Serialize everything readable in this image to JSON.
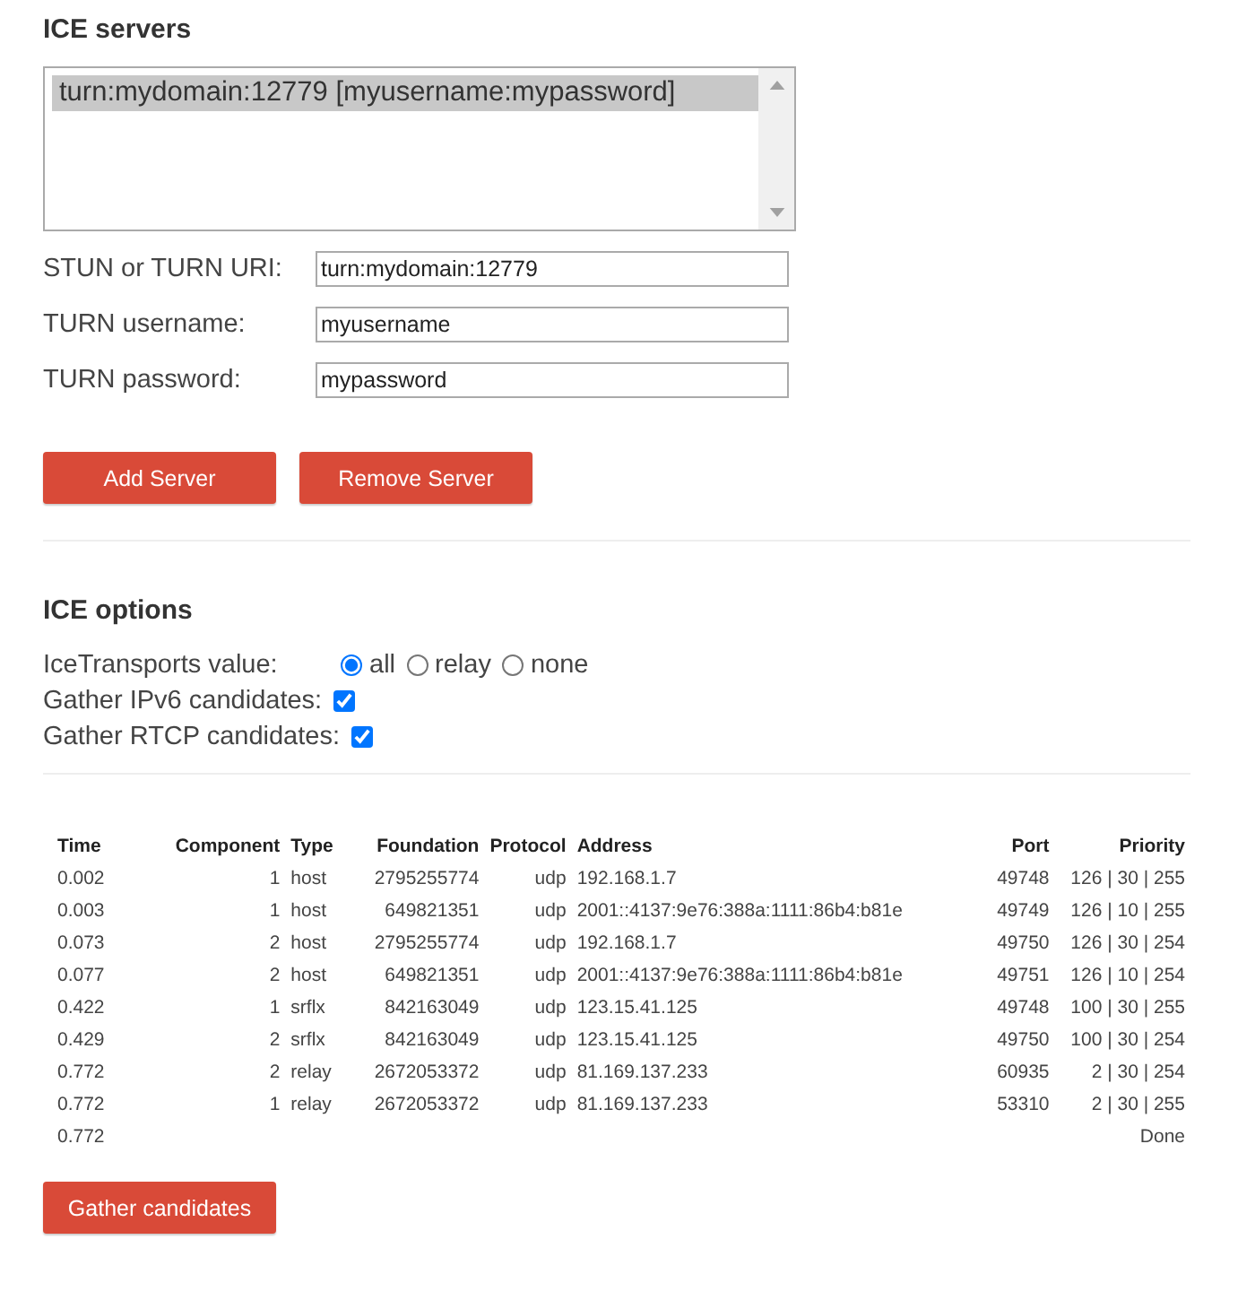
{
  "ice_servers": {
    "title": "ICE servers",
    "server_list": [
      {
        "label": "turn:mydomain:12779 [myusername:mypassword]",
        "selected": true
      }
    ],
    "fields": [
      {
        "label": "STUN or TURN URI:",
        "value": "turn:mydomain:12779"
      },
      {
        "label": "TURN username:",
        "value": "myusername"
      },
      {
        "label": "TURN password:",
        "value": "mypassword"
      }
    ],
    "buttons": [
      "Add Server",
      "Remove Server"
    ]
  },
  "ice_options": {
    "title": "ICE options",
    "transports": {
      "label": "IceTransports value:",
      "options": [
        {
          "label": "all",
          "selected": true
        },
        {
          "label": "relay",
          "selected": false
        },
        {
          "label": "none",
          "selected": false
        }
      ]
    },
    "checkboxes": [
      {
        "label": "Gather IPv6 candidates:",
        "checked": true
      },
      {
        "label": "Gather RTCP candidates:",
        "checked": true
      }
    ]
  },
  "candidates": {
    "columns": [
      "Time",
      "Component",
      "Type",
      "Foundation",
      "Protocol",
      "Address",
      "Port",
      "Priority"
    ],
    "rows": [
      [
        "0.002",
        "1",
        "host",
        "2795255774",
        "udp",
        "192.168.1.7",
        "49748",
        "126 | 30 | 255"
      ],
      [
        "0.003",
        "1",
        "host",
        "649821351",
        "udp",
        "2001::4137:9e76:388a:1111:86b4:b81e",
        "49749",
        "126 | 10 | 255"
      ],
      [
        "0.073",
        "2",
        "host",
        "2795255774",
        "udp",
        "192.168.1.7",
        "49750",
        "126 | 30 | 254"
      ],
      [
        "0.077",
        "2",
        "host",
        "649821351",
        "udp",
        "2001::4137:9e76:388a:1111:86b4:b81e",
        "49751",
        "126 | 10 | 254"
      ],
      [
        "0.422",
        "1",
        "srflx",
        "842163049",
        "udp",
        "123.15.41.125",
        "49748",
        "100 | 30 | 255"
      ],
      [
        "0.429",
        "2",
        "srflx",
        "842163049",
        "udp",
        "123.15.41.125",
        "49750",
        "100 | 30 | 254"
      ],
      [
        "0.772",
        "2",
        "relay",
        "2672053372",
        "udp",
        "81.169.137.233",
        "60935",
        "2 | 30 | 254"
      ],
      [
        "0.772",
        "1",
        "relay",
        "2672053372",
        "udp",
        "81.169.137.233",
        "53310",
        "2 | 30 | 255"
      ],
      [
        "0.772",
        "",
        "",
        "",
        "",
        "",
        "",
        "Done"
      ]
    ]
  },
  "gather_button": "Gather candidates"
}
